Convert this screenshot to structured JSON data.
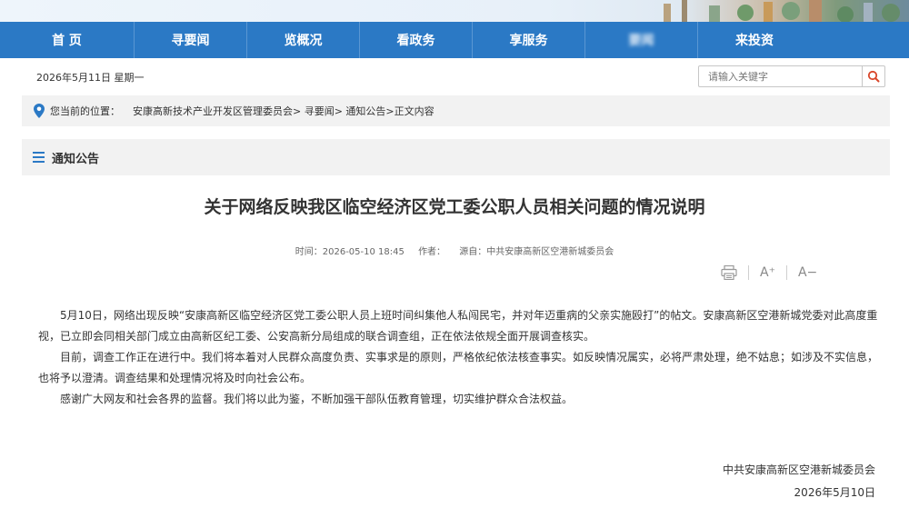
{
  "nav": {
    "items": [
      "首 页",
      "寻要闻",
      "览概况",
      "看政务",
      "享服务",
      "要闻",
      "来投资"
    ]
  },
  "topbar": {
    "date": "2026年5月11日 星期一",
    "search_placeholder": "请输入关键字"
  },
  "breadcrumb": {
    "label": "您当前的位置：",
    "path": "安康高新技术产业开发区管理委员会> 寻要闻> 通知公告>正文内容"
  },
  "section": {
    "title": "通知公告"
  },
  "article": {
    "title": "关于网络反映我区临空经济区党工委公职人员相关问题的情况说明",
    "time_label": "时间：2026-05-10 18:45",
    "author_label": "作者：",
    "source_label": "源自：中共安康高新区空港新城委员会",
    "paragraphs": [
      "5月10日，网络出现反映“安康高新区临空经济区党工委公职人员上班时间纠集他人私闯民宅，并对年迈重病的父亲实施殴打”的帖文。安康高新区空港新城党委对此高度重视，已立即会同相关部门成立由高新区纪工委、公安高新分局组成的联合调查组，正在依法依规全面开展调查核实。",
      "目前，调查工作正在进行中。我们将本着对人民群众高度负责、实事求是的原则，严格依纪依法核查事实。如反映情况属实，必将严肃处理，绝不姑息；如涉及不实信息，也将予以澄清。调查结果和处理情况将及时向社会公布。",
      "感谢广大网友和社会各界的监督。我们将以此为鉴，不断加强干部队伍教育管理，切实维护群众合法权益。"
    ],
    "signature_org": "中共安康高新区空港新城委员会",
    "signature_date": "2026年5月10日"
  },
  "tools": {
    "font_increase": "A⁺",
    "font_decrease": "A−"
  },
  "colors": {
    "nav_bg": "#2b79c5",
    "search_icon": "#d9472b",
    "pin_icon": "#2b79c5",
    "panel_bg": "#f2f2f2"
  },
  "icons": {
    "search": "search-icon",
    "location": "location-pin-icon",
    "menu": "menu-icon",
    "print": "print-icon"
  }
}
